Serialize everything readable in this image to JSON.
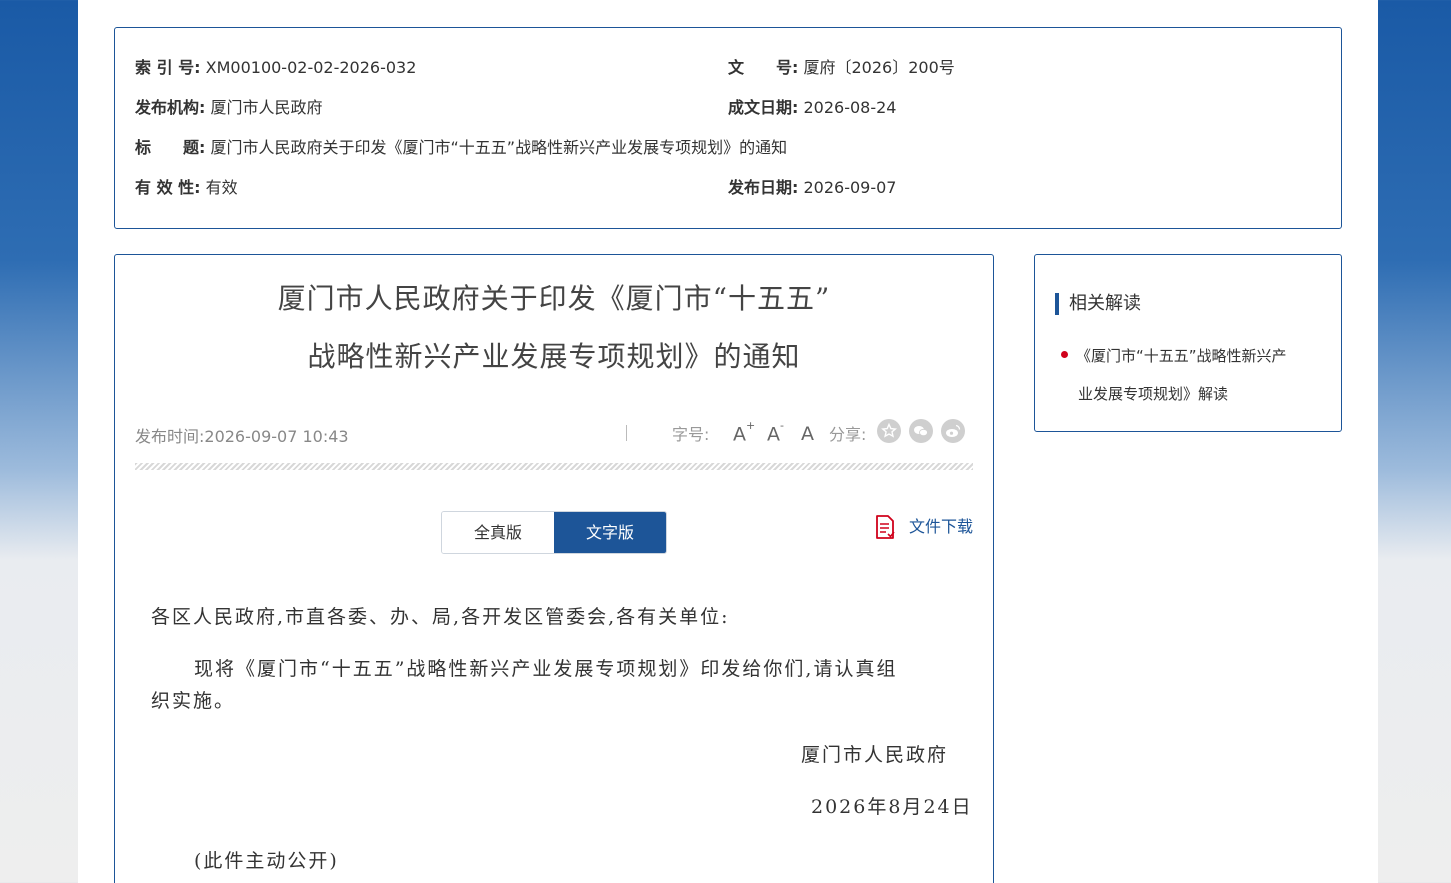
{
  "info": {
    "index_label": "索 引 号:",
    "index_value": "XM00100-02-02-2026-032",
    "docno_label": "文　　号:",
    "docno_value": "厦府〔2026〕200号",
    "org_label": "发布机构:",
    "org_value": "厦门市人民政府",
    "date_written_label": "成文日期:",
    "date_written_value": "2026-08-24",
    "title_label": "标　　题:",
    "title_value": "厦门市人民政府关于印发《厦门市“十五五”战略性新兴产业发展专项规划》的通知",
    "validity_label": "有 效 性:",
    "validity_value": "有效",
    "publish_date_label": "发布日期:",
    "publish_date_value": "2026-09-07"
  },
  "article": {
    "title_line1": "厦门市人民政府关于印发《厦门市“十五五”",
    "title_line2": "战略性新兴产业发展专项规划》的通知",
    "publish_time": "发布时间:2026-09-07 10:43",
    "font_size_label": "字号:",
    "font_large": "A",
    "font_large_sup": "+",
    "font_small": "A",
    "font_small_sup": "-",
    "font_default": "A",
    "share_label": "分享:",
    "share_icons": [
      "favorite-icon",
      "wechat-icon",
      "weibo-icon"
    ],
    "tabs": [
      "全真版",
      "文字版"
    ],
    "active_tab": "文字版",
    "download_label": "文件下载",
    "salutation": "各区人民政府,市直各委、办、局,各开发区管委会,各有关单位:",
    "paragraph_line1": "现将《厦门市“十五五”战略性新兴产业发展专项规划》印发给你们,请认真组",
    "paragraph_line2": "织实施。",
    "signature": "厦门市人民政府",
    "sign_date": "2026年8月24日",
    "note": "(此件主动公开)"
  },
  "sidebar": {
    "title": "相关解读",
    "link_line1": "《厦门市“十五五”战略性新兴产",
    "link_line2": "业发展专项规划》解读"
  },
  "colors": {
    "brand_blue": "#1d5598",
    "bullet_red": "#d0021b"
  }
}
